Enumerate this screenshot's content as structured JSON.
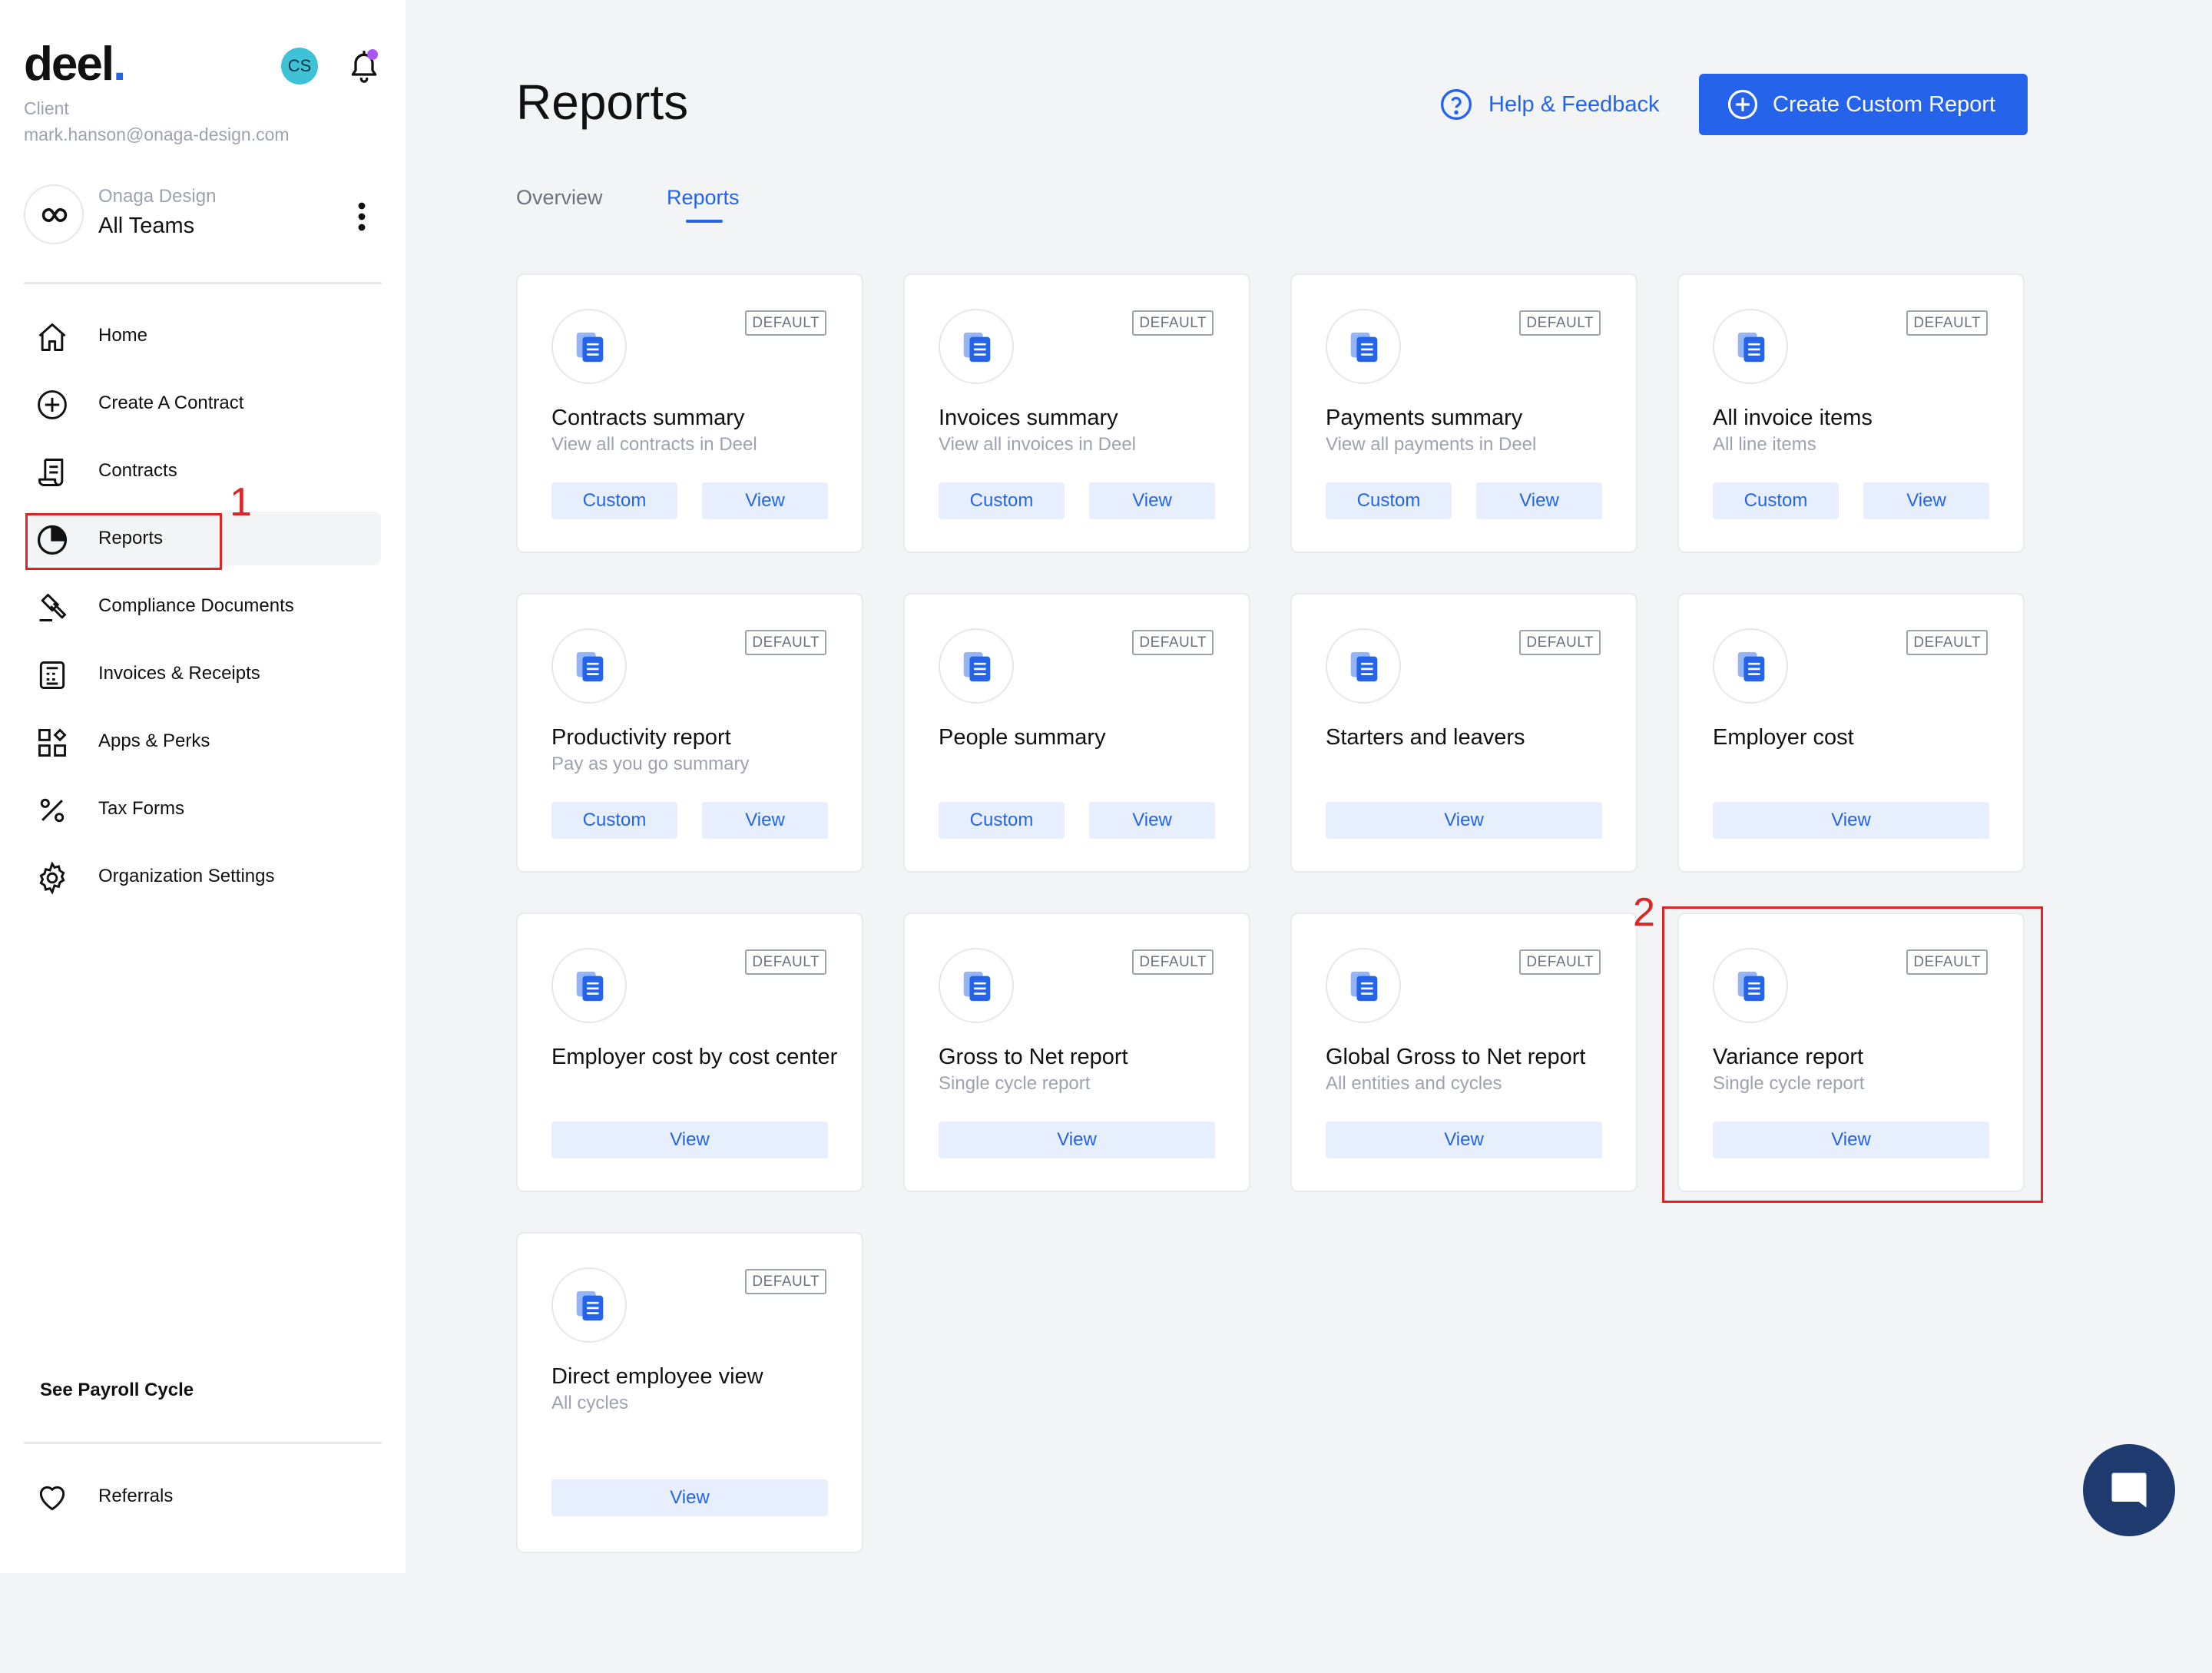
{
  "brand": {
    "logo_text": "deel",
    "logo_dot": "."
  },
  "user": {
    "role": "Client",
    "email": "mark.hanson@onaga-design.com",
    "initials": "CS"
  },
  "team": {
    "org": "Onaga Design",
    "name": "All Teams"
  },
  "sidebar": {
    "items": [
      {
        "label": "Home",
        "icon": "home-icon"
      },
      {
        "label": "Create A Contract",
        "icon": "plus-circle-icon"
      },
      {
        "label": "Contracts",
        "icon": "contract-icon"
      },
      {
        "label": "Reports",
        "icon": "pie-chart-icon",
        "active": true
      },
      {
        "label": "Compliance Documents",
        "icon": "gavel-icon"
      },
      {
        "label": "Invoices & Receipts",
        "icon": "receipt-icon"
      },
      {
        "label": "Apps & Perks",
        "icon": "apps-icon"
      },
      {
        "label": "Tax Forms",
        "icon": "percent-icon"
      },
      {
        "label": "Organization Settings",
        "icon": "gear-icon"
      }
    ],
    "payroll_link": "See Payroll Cycle",
    "referrals": "Referrals"
  },
  "header": {
    "title": "Reports",
    "help_label": "Help & Feedback",
    "create_label": "Create Custom Report"
  },
  "tabs": [
    {
      "label": "Overview",
      "active": false
    },
    {
      "label": "Reports",
      "active": true
    }
  ],
  "cards": [
    {
      "title": "Contracts summary",
      "subtitle": "View all contracts in Deel",
      "badge": "DEFAULT",
      "custom": "Custom",
      "view": "View"
    },
    {
      "title": "Invoices summary",
      "subtitle": "View all invoices in Deel",
      "badge": "DEFAULT",
      "custom": "Custom",
      "view": "View"
    },
    {
      "title": "Payments summary",
      "subtitle": "View all payments in Deel",
      "badge": "DEFAULT",
      "custom": "Custom",
      "view": "View"
    },
    {
      "title": "All invoice items",
      "subtitle": "All line items",
      "badge": "DEFAULT",
      "custom": "Custom",
      "view": "View"
    },
    {
      "title": "Productivity report",
      "subtitle": "Pay as you go summary",
      "badge": "DEFAULT",
      "custom": "Custom",
      "view": "View"
    },
    {
      "title": "People summary",
      "subtitle": "",
      "badge": "DEFAULT",
      "custom": "Custom",
      "view": "View"
    },
    {
      "title": "Starters and leavers",
      "subtitle": "",
      "badge": "DEFAULT",
      "view": "View"
    },
    {
      "title": "Employer cost",
      "subtitle": "",
      "badge": "DEFAULT",
      "view": "View"
    },
    {
      "title": "Employer cost by cost center",
      "subtitle": "",
      "badge": "DEFAULT",
      "view": "View"
    },
    {
      "title": "Gross to Net report",
      "subtitle": "Single cycle report",
      "badge": "DEFAULT",
      "view": "View"
    },
    {
      "title": "Global Gross to Net report",
      "subtitle": "All entities and cycles",
      "badge": "DEFAULT",
      "view": "View"
    },
    {
      "title": "Variance report",
      "subtitle": "Single cycle report",
      "badge": "DEFAULT",
      "view": "View"
    },
    {
      "title": "Direct employee view",
      "subtitle": "All cycles",
      "badge": "DEFAULT",
      "view": "View"
    }
  ],
  "annotations": [
    {
      "number": "1"
    },
    {
      "number": "2"
    }
  ],
  "colors": {
    "accent": "#2563eb",
    "annotation": "#dc2626",
    "chat": "#1e3a6e"
  }
}
